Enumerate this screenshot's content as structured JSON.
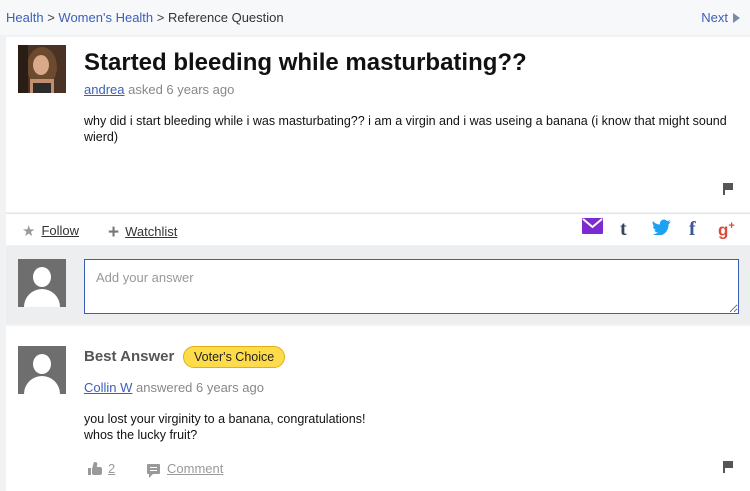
{
  "breadcrumb": {
    "items": [
      "Health",
      "Women's Health"
    ],
    "separator": ">",
    "current": "Reference Question",
    "next_label": "Next"
  },
  "question": {
    "title": "Started bleeding while masturbating??",
    "author": "andrea",
    "asked_text": "asked 6 years ago",
    "body": "why did i start bleeding while i was masturbating?? i am a virgin and i was useing a banana (i know that might sound wierd)"
  },
  "actions": {
    "follow_label": "Follow",
    "watchlist_label": "Watchlist",
    "share_icons": [
      "mail-icon",
      "tumblr-icon",
      "twitter-icon",
      "facebook-icon",
      "google-plus-icon"
    ]
  },
  "answer_input": {
    "placeholder": "Add your answer"
  },
  "best_answer": {
    "label": "Best Answer",
    "badge": "Voter's Choice",
    "author": "Collin W",
    "answered_text": "answered 6 years ago",
    "body_lines": [
      "you lost your virginity to a banana, congratulations!",
      "whos the lucky fruit?"
    ],
    "likes": "2",
    "comment_label": "Comment"
  },
  "colors": {
    "link": "#3b5fb8",
    "badge": "#fedb4b",
    "mail": "#7b2bd0",
    "twitter": "#1da1f2",
    "facebook": "#3b5998",
    "google_plus": "#dd4b39"
  }
}
